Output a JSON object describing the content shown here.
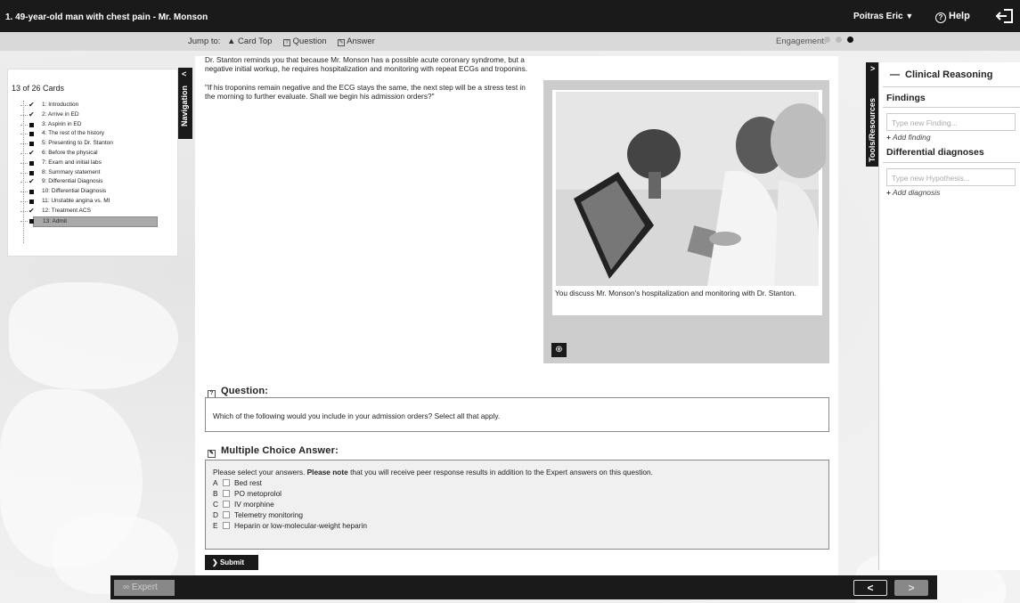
{
  "header": {
    "title": "1. 49-year-old man with chest pain - Mr. Monson",
    "user": "Poitras Eric",
    "user_caret": "⌄",
    "help": "Help"
  },
  "jumpbar": {
    "jump_to": "Jump to:",
    "card_top": "Card Top",
    "question": "Question",
    "answer": "Answer",
    "engagement": "Engagement:",
    "engagement_level": 3
  },
  "navigation": {
    "tab_label": "Navigation",
    "count": "13 of 26 Cards",
    "items": [
      {
        "label": "1: Introduction",
        "status": "check"
      },
      {
        "label": "2: Arrive in ED",
        "status": "check"
      },
      {
        "label": "3: Aspirin in ED",
        "status": "square"
      },
      {
        "label": "4: The rest of the history",
        "status": "square"
      },
      {
        "label": "5: Presenting to Dr. Stanton",
        "status": "square"
      },
      {
        "label": "6: Before the physical",
        "status": "check"
      },
      {
        "label": "7: Exam and initial labs",
        "status": "square"
      },
      {
        "label": "8: Summary statement",
        "status": "square"
      },
      {
        "label": "9: Differential Diagnosis",
        "status": "check"
      },
      {
        "label": "10: Differential Diagnosis",
        "status": "square"
      },
      {
        "label": "11: Unstable angina vs. MI",
        "status": "square"
      },
      {
        "label": "12: Treatment ACS",
        "status": "check"
      },
      {
        "label": "13: Admit",
        "status": "square",
        "selected": true
      }
    ]
  },
  "card": {
    "para1": "Dr. Stanton reminds you that because Mr. Monson has a possible acute coronary syndrome, but a negative initial workup, he requires hospitalization and monitoring with repeat ECGs and troponins.",
    "para2": "\"If his troponins remain negative and the ECG stays the same, the next step will be a stress test in the morning to further evaluate.  Shall we begin his admission orders?\"",
    "image_caption": "You discuss Mr. Monson's hospitalization and monitoring with Dr. Stanton."
  },
  "question": {
    "heading": "Question:",
    "text": "Which of the following would you include in your admission orders? Select all that apply."
  },
  "answer": {
    "heading": "Multiple Choice Answer:",
    "intro_pre": "Please select your answers.",
    "intro_note": "Please note",
    "intro_post": "that you will receive peer response results in addition to the Expert answers on this question.",
    "options": [
      {
        "letter": "A",
        "text": "Bed rest",
        "checked": false
      },
      {
        "letter": "B",
        "text": "PO metoprolol",
        "checked": false
      },
      {
        "letter": "C",
        "text": "IV morphine",
        "checked": false
      },
      {
        "letter": "D",
        "text": "Telemetry monitoring",
        "checked": false
      },
      {
        "letter": "E",
        "text": "Heparin or low-molecular-weight heparin",
        "checked": false
      }
    ],
    "submit": "Submit"
  },
  "tools": {
    "tab_label": "Tools/Resources",
    "section": "Clinical Reasoning",
    "findings_heading": "Findings",
    "finding_placeholder": "Type new Finding...",
    "add_finding": "Add finding",
    "diagnoses_heading": "Differential diagnoses",
    "hypothesis_placeholder": "Type new Hypothesis...",
    "add_diagnosis": "Add diagnosis"
  },
  "footer": {
    "expert": "Expert",
    "expert_icon": "∞"
  },
  "colors": {
    "bar": "#1a1a1a",
    "jumpbar": "#d9d9d9",
    "selected": "#aaaaaa"
  }
}
